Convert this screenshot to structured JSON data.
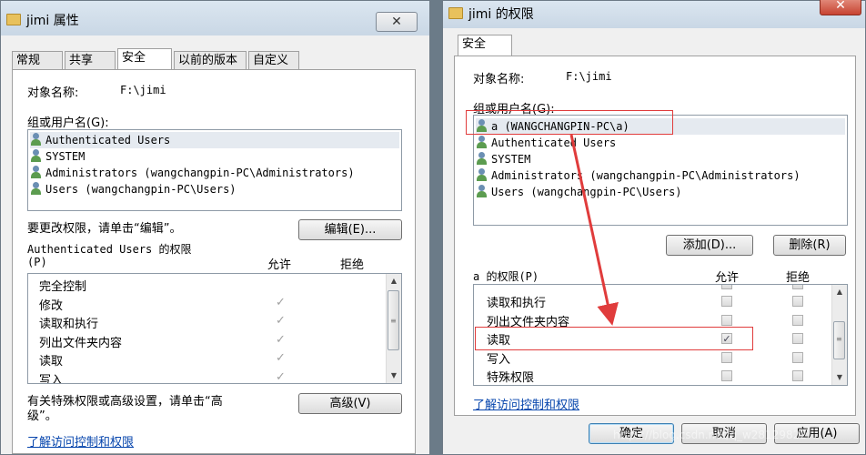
{
  "left_window": {
    "title": "jimi 属性",
    "close_label": "✕",
    "tabs": [
      "常规",
      "共享",
      "安全",
      "以前的版本",
      "自定义"
    ],
    "active_tab": "安全",
    "object_label": "对象名称:",
    "object_value": "F:\\jimi",
    "group_label": "组或用户名(G):",
    "users": [
      "Authenticated Users",
      "SYSTEM",
      "Administrators (wangchangpin-PC\\Administrators)",
      "Users (wangchangpin-PC\\Users)"
    ],
    "edit_hint": "要更改权限，请单击“编辑”。",
    "edit_button": "编辑(E)...",
    "perm_title_line1": "Authenticated Users 的权限",
    "perm_title_line2": "(P)",
    "allow_header": "允许",
    "deny_header": "拒绝",
    "permissions": [
      {
        "name": "完全控制",
        "allow": false
      },
      {
        "name": "修改",
        "allow": true
      },
      {
        "name": "读取和执行",
        "allow": true
      },
      {
        "name": "列出文件夹内容",
        "allow": true
      },
      {
        "name": "读取",
        "allow": true
      },
      {
        "name": "写入",
        "allow": true
      }
    ],
    "advanced_hint_line1": "有关特殊权限或高级设置，请单击“高",
    "advanced_hint_line2": "级”。",
    "advanced_button": "高级(V)",
    "help_link": "了解访问控制和权限"
  },
  "right_window": {
    "title": "jimi 的权限",
    "tab": "安全",
    "object_label": "对象名称:",
    "object_value": "F:\\jimi",
    "group_label": "组或用户名(G):",
    "users": [
      "a (WANGCHANGPIN-PC\\a)",
      "Authenticated Users",
      "SYSTEM",
      "Administrators (wangchangpin-PC\\Administrators)",
      "Users (wangchangpin-PC\\Users)"
    ],
    "add_button": "添加(D)...",
    "remove_button": "删除(R)",
    "perm_title": "a 的权限(P)",
    "allow_header": "允许",
    "deny_header": "拒绝",
    "permissions": [
      {
        "name": "读取和执行",
        "allow": false
      },
      {
        "name": "列出文件夹内容",
        "allow": false
      },
      {
        "name": "读取",
        "allow": true
      },
      {
        "name": "写入",
        "allow": false
      },
      {
        "name": "特殊权限",
        "allow": false
      }
    ],
    "help_link": "了解访问控制和权限",
    "ok_button": "确定",
    "cancel_button": "取消",
    "apply_button": "应用(A)"
  },
  "annotation_color": "#e03c3c",
  "watermark": "https://blog.csdn.net/q_w28129822"
}
